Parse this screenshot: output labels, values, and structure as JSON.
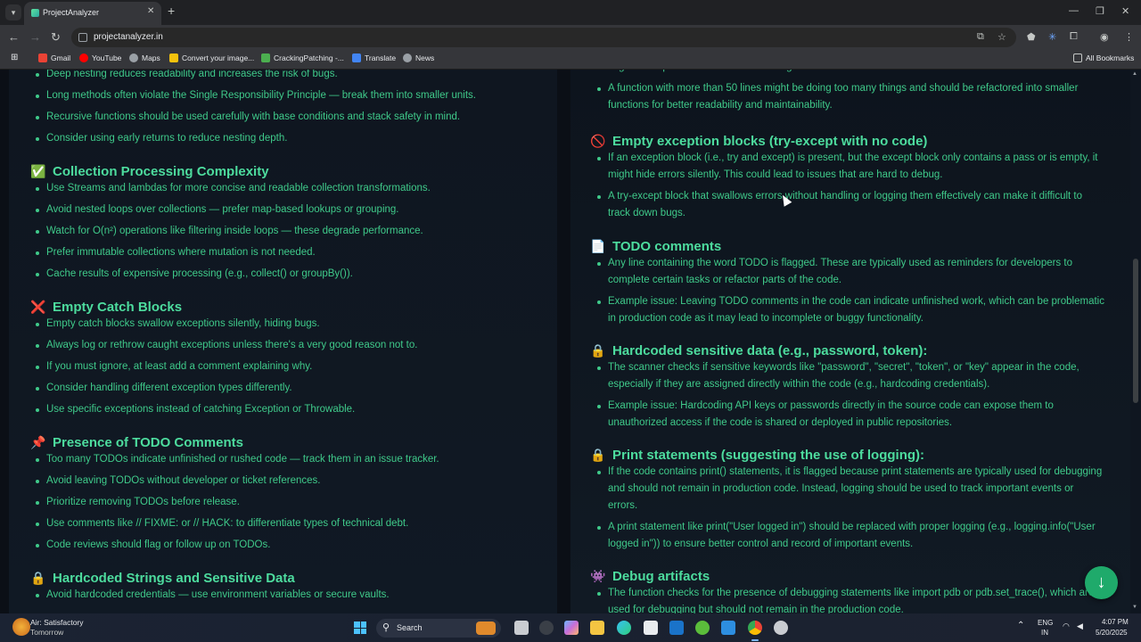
{
  "browser": {
    "tab_title": "ProjectAnalyzer",
    "url": "projectanalyzer.in",
    "bookmarks": [
      "Gmail",
      "YouTube",
      "Maps",
      "Convert your image...",
      "CrackingPatching -...",
      "Translate",
      "News"
    ],
    "all_bookmarks": "All Bookmarks"
  },
  "left_sections": [
    {
      "heading": "",
      "icon": "",
      "items": [
        "Deep nesting reduces readability and increases the risk of bugs.",
        "Long methods often violate the Single Responsibility Principle — break them into smaller units.",
        "Recursive functions should be used carefully with base conditions and stack safety in mind.",
        "Consider using early returns to reduce nesting depth."
      ]
    },
    {
      "heading": "Collection Processing Complexity",
      "icon": "✅",
      "items": [
        "Use Streams and lambdas for more concise and readable collection transformations.",
        "Avoid nested loops over collections — prefer map-based lookups or grouping.",
        "Watch for O(n²) operations like filtering inside loops — these degrade performance.",
        "Prefer immutable collections where mutation is not needed.",
        "Cache results of expensive processing (e.g., collect() or groupBy())."
      ]
    },
    {
      "heading": "Empty Catch Blocks",
      "icon": "❌",
      "items": [
        "Empty catch blocks swallow exceptions silently, hiding bugs.",
        "Always log or rethrow caught exceptions unless there's a very good reason not to.",
        "If you must ignore, at least add a comment explaining why.",
        "Consider handling different exception types differently.",
        "Use specific exceptions instead of catching Exception or Throwable."
      ]
    },
    {
      "heading": "Presence of TODO Comments",
      "icon": "📌",
      "items": [
        "Too many TODOs indicate unfinished or rushed code — track them in an issue tracker.",
        "Avoid leaving TODOs without developer or ticket references.",
        "Prioritize removing TODOs before release.",
        "Use comments like // FIXME: or // HACK: to differentiate types of technical debt.",
        "Code reviews should flag or follow up on TODOs."
      ]
    },
    {
      "heading": "Hardcoded Strings and Sensitive Data",
      "icon": "🔒",
      "items": [
        "Avoid hardcoded credentials — use environment variables or secure vaults."
      ]
    }
  ],
  "right_sections": [
    {
      "heading": "",
      "icon": "",
      "items": [
        "flags it as a potential issue because long functions can be harder to understand and maintain.",
        "A function with more than 50 lines might be doing too many things and should be refactored into smaller functions for better readability and maintainability."
      ]
    },
    {
      "heading": "Empty exception blocks (try-except with no code)",
      "icon": "🚫",
      "items": [
        "If an exception block (i.e., try and except) is present, but the except block only contains a pass or is empty, it might hide errors silently. This could lead to issues that are hard to debug.",
        "A try-except block that swallows errors without handling or logging them effectively can make it difficult to track down bugs."
      ]
    },
    {
      "heading": "TODO comments",
      "icon": "📄",
      "items": [
        "Any line containing the word TODO is flagged. These are typically used as reminders for developers to complete certain tasks or refactor parts of the code.",
        "Example issue: Leaving TODO comments in the code can indicate unfinished work, which can be problematic in production code as it may lead to incomplete or buggy functionality."
      ]
    },
    {
      "heading": "Hardcoded sensitive data (e.g., password, token):",
      "icon": "🔒",
      "items": [
        "The scanner checks if sensitive keywords like \"password\", \"secret\", \"token\", or \"key\" appear in the code, especially if they are assigned directly within the code (e.g., hardcoding credentials).",
        "Example issue: Hardcoding API keys or passwords directly in the source code can expose them to unauthorized access if the code is shared or deployed in public repositories."
      ]
    },
    {
      "heading": "Print statements (suggesting the use of logging):",
      "icon": "🔒",
      "items": [
        "If the code contains print() statements, it is flagged because print statements are typically used for debugging and should not remain in production code. Instead, logging should be used to track important events or errors.",
        "A print statement like print(\"User logged in\") should be replaced with proper logging (e.g., logging.info(\"User logged in\")) to ensure better control and record of important events."
      ]
    },
    {
      "heading": "Debug artifacts",
      "icon": "👾",
      "items": [
        "The function checks for the presence of debugging statements like import pdb or pdb.set_trace(), which are used for debugging but should not remain in the production code."
      ]
    }
  ],
  "taskbar": {
    "weather_title": "Air: Satisfactory",
    "weather_sub": "Tomorrow",
    "search_label": "Search",
    "lang_top": "ENG",
    "lang_bottom": "IN",
    "time": "4:07 PM",
    "date": "5/20/2025"
  },
  "colors": {
    "accent_green": "#4ddc9e",
    "text_green": "#3fca8a",
    "panel_bg": "#0f1620",
    "fab": "#1faa6b"
  }
}
